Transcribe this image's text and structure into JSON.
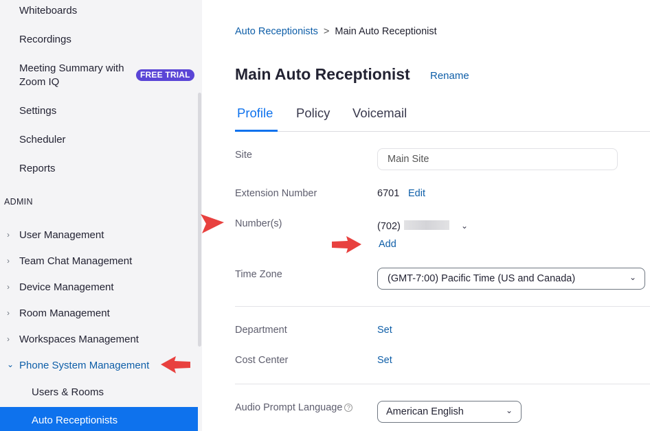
{
  "sidebar": {
    "items": [
      "Whiteboards",
      "Recordings",
      "Meeting Summary with",
      "Zoom IQ",
      "Settings",
      "Scheduler",
      "Reports"
    ],
    "free_trial": "FREE TRIAL",
    "admin_label": "ADMIN",
    "admin_items": [
      "User Management",
      "Team Chat Management",
      "Device Management",
      "Room Management",
      "Workspaces Management",
      "Phone System Management"
    ],
    "sub_items": [
      "Users & Rooms",
      "Auto Receptionists"
    ]
  },
  "breadcrumb": {
    "parent": "Auto Receptionists",
    "separator": ">",
    "current": "Main Auto Receptionist"
  },
  "page": {
    "title": "Main Auto Receptionist",
    "rename": "Rename"
  },
  "tabs": [
    "Profile",
    "Policy",
    "Voicemail"
  ],
  "profile": {
    "site_label": "Site",
    "site_value": "Main Site",
    "extension_label": "Extension Number",
    "extension_value": "6701",
    "edit": "Edit",
    "numbers_label": "Number(s)",
    "number_value": "(702)",
    "add": "Add",
    "timezone_label": "Time Zone",
    "timezone_value": "(GMT-7:00) Pacific Time (US and Canada)",
    "department_label": "Department",
    "cost_center_label": "Cost Center",
    "set": "Set",
    "audio_label": "Audio Prompt Language",
    "audio_value": "American English"
  },
  "colors": {
    "accent": "#0e72ed",
    "link": "#0e5ea8",
    "annotation_arrow": "#e8413f",
    "badge": "#5a45d6"
  }
}
